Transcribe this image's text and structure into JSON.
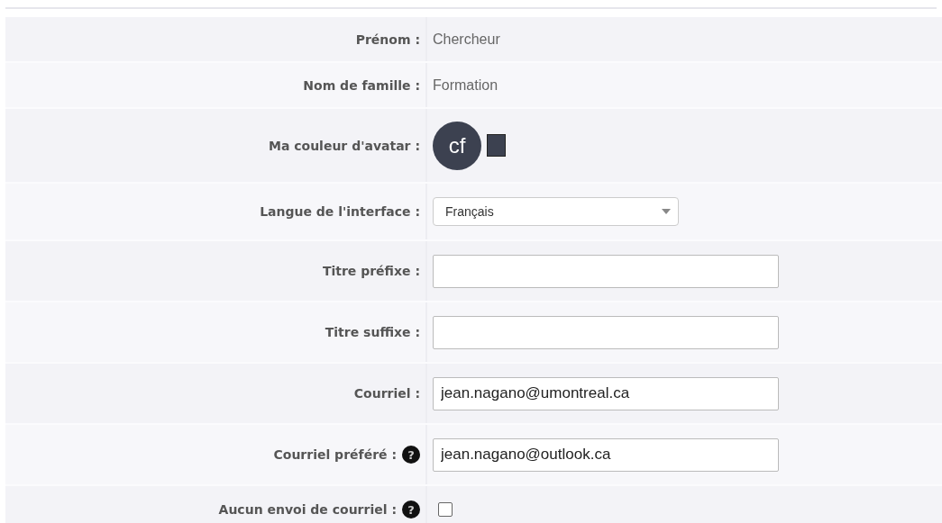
{
  "fields": [
    {
      "kind": "text",
      "label": "Prénom :",
      "value": "Chercheur"
    },
    {
      "kind": "text",
      "label": "Nom de famille :",
      "value": "Formation"
    },
    {
      "kind": "avatar",
      "label": "Ma couleur d'avatar :",
      "initials": "cf",
      "color": "#3c4150"
    },
    {
      "kind": "select",
      "label": "Langue de l'interface :",
      "value": "Français"
    },
    {
      "kind": "input",
      "label": "Titre préfixe :"
    },
    {
      "kind": "input",
      "label": "Titre suffixe :"
    },
    {
      "kind": "input",
      "label": "Courriel :",
      "value": "jean.nagano@umontreal.ca"
    },
    {
      "kind": "input",
      "label": "Courriel préféré :",
      "help": "?",
      "value": "jean.nagano@outlook.ca"
    },
    {
      "kind": "checkbox",
      "label": "Aucun envoi de courriel :",
      "help": "?",
      "checked": false
    }
  ]
}
